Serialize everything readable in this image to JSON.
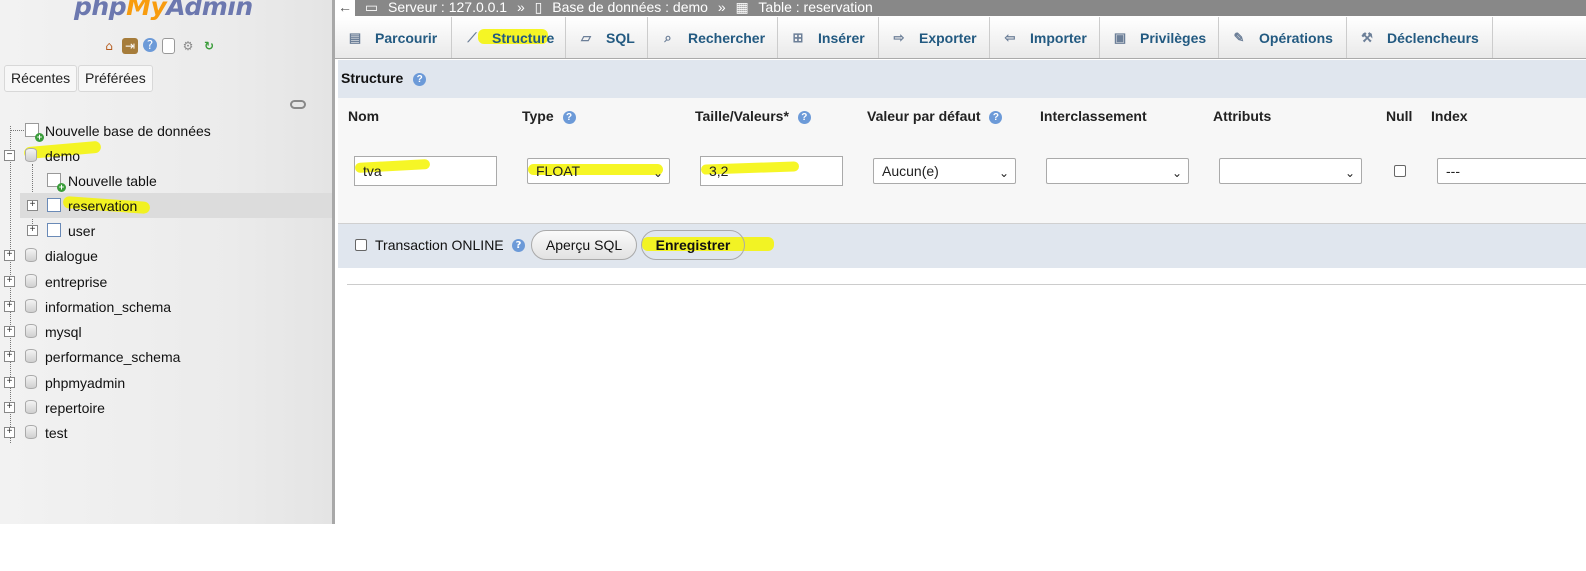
{
  "sidebar": {
    "logo": {
      "php": "php",
      "my": "My",
      "admin": "Admin"
    },
    "quick_icons": [
      "home-icon",
      "logout-icon",
      "help-icon",
      "docs-icon",
      "settings-icon",
      "reload-icon"
    ],
    "tabs": [
      "Récentes",
      "Préférées"
    ],
    "tree": {
      "new_db": "Nouvelle base de données",
      "databases": [
        {
          "name": "demo",
          "expanded": true,
          "children": [
            "Nouvelle table",
            "reservation",
            "user"
          ]
        },
        {
          "name": "dialogue"
        },
        {
          "name": "entreprise"
        },
        {
          "name": "information_schema"
        },
        {
          "name": "mysql"
        },
        {
          "name": "performance_schema"
        },
        {
          "name": "phpmyadmin"
        },
        {
          "name": "repertoire"
        },
        {
          "name": "test"
        }
      ]
    }
  },
  "breadcrumb": {
    "back": "←",
    "server": "Serveur : 127.0.0.1",
    "sep": "»",
    "database": "Base de données : demo",
    "table": "Table : reservation"
  },
  "tabs": [
    {
      "label": "Parcourir",
      "icon": "browse-icon"
    },
    {
      "label": "Structure",
      "icon": "structure-icon",
      "active": true
    },
    {
      "label": "SQL",
      "icon": "sql-icon"
    },
    {
      "label": "Rechercher",
      "icon": "search-icon"
    },
    {
      "label": "Insérer",
      "icon": "insert-icon"
    },
    {
      "label": "Exporter",
      "icon": "export-icon"
    },
    {
      "label": "Importer",
      "icon": "import-icon"
    },
    {
      "label": "Privilèges",
      "icon": "privileges-icon"
    },
    {
      "label": "Opérations",
      "icon": "operations-icon"
    },
    {
      "label": "Déclencheurs",
      "icon": "triggers-icon"
    }
  ],
  "structure": {
    "title": "Structure",
    "columns": {
      "name": "Nom",
      "type": "Type",
      "length": "Taille/Valeurs*",
      "default": "Valeur par défaut",
      "collation": "Interclassement",
      "attributes": "Attributs",
      "null": "Null",
      "index": "Index"
    },
    "row": {
      "name": "tva",
      "type": "FLOAT",
      "length": "3,2",
      "default": "Aucun(e)",
      "collation": "",
      "attributes": "",
      "null": false,
      "index": "---"
    }
  },
  "footer": {
    "transaction_label": "Transaction ONLINE",
    "preview_button": "Aperçu SQL",
    "save_button": "Enregistrer"
  },
  "colors": {
    "highlight": "#f5f500",
    "tab_text": "#235a81",
    "panel_bg": "#e0e6ee"
  }
}
